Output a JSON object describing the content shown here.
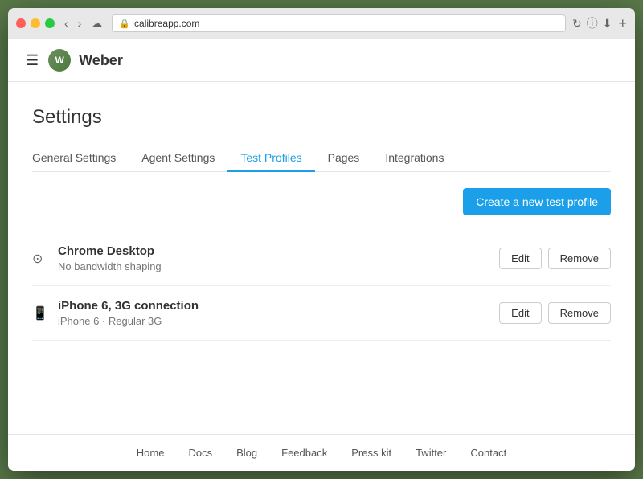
{
  "browser": {
    "url": "calibreapp.com",
    "add_tab_label": "+"
  },
  "nav": {
    "menu_label": "☰",
    "site_name": "Weber",
    "avatar_initials": "W"
  },
  "page": {
    "title": "Settings"
  },
  "tabs": [
    {
      "id": "general",
      "label": "General Settings",
      "active": false
    },
    {
      "id": "agent",
      "label": "Agent Settings",
      "active": false
    },
    {
      "id": "test-profiles",
      "label": "Test Profiles",
      "active": true
    },
    {
      "id": "pages",
      "label": "Pages",
      "active": false
    },
    {
      "id": "integrations",
      "label": "Integrations",
      "active": false
    }
  ],
  "toolbar": {
    "create_button_label": "Create a new test profile"
  },
  "profiles": [
    {
      "id": "chrome-desktop",
      "icon": "🎯",
      "icon_type": "target",
      "name": "Chrome Desktop",
      "detail": "No bandwidth shaping",
      "edit_label": "Edit",
      "remove_label": "Remove"
    },
    {
      "id": "iphone-6",
      "icon": "📱",
      "icon_type": "phone",
      "name": "iPhone 6, 3G connection",
      "detail": "iPhone 6  ·  Regular 3G",
      "edit_label": "Edit",
      "remove_label": "Remove"
    }
  ],
  "footer": {
    "links": [
      {
        "id": "home",
        "label": "Home"
      },
      {
        "id": "docs",
        "label": "Docs"
      },
      {
        "id": "blog",
        "label": "Blog"
      },
      {
        "id": "feedback",
        "label": "Feedback"
      },
      {
        "id": "press-kit",
        "label": "Press kit"
      },
      {
        "id": "twitter",
        "label": "Twitter"
      },
      {
        "id": "contact",
        "label": "Contact"
      }
    ]
  }
}
